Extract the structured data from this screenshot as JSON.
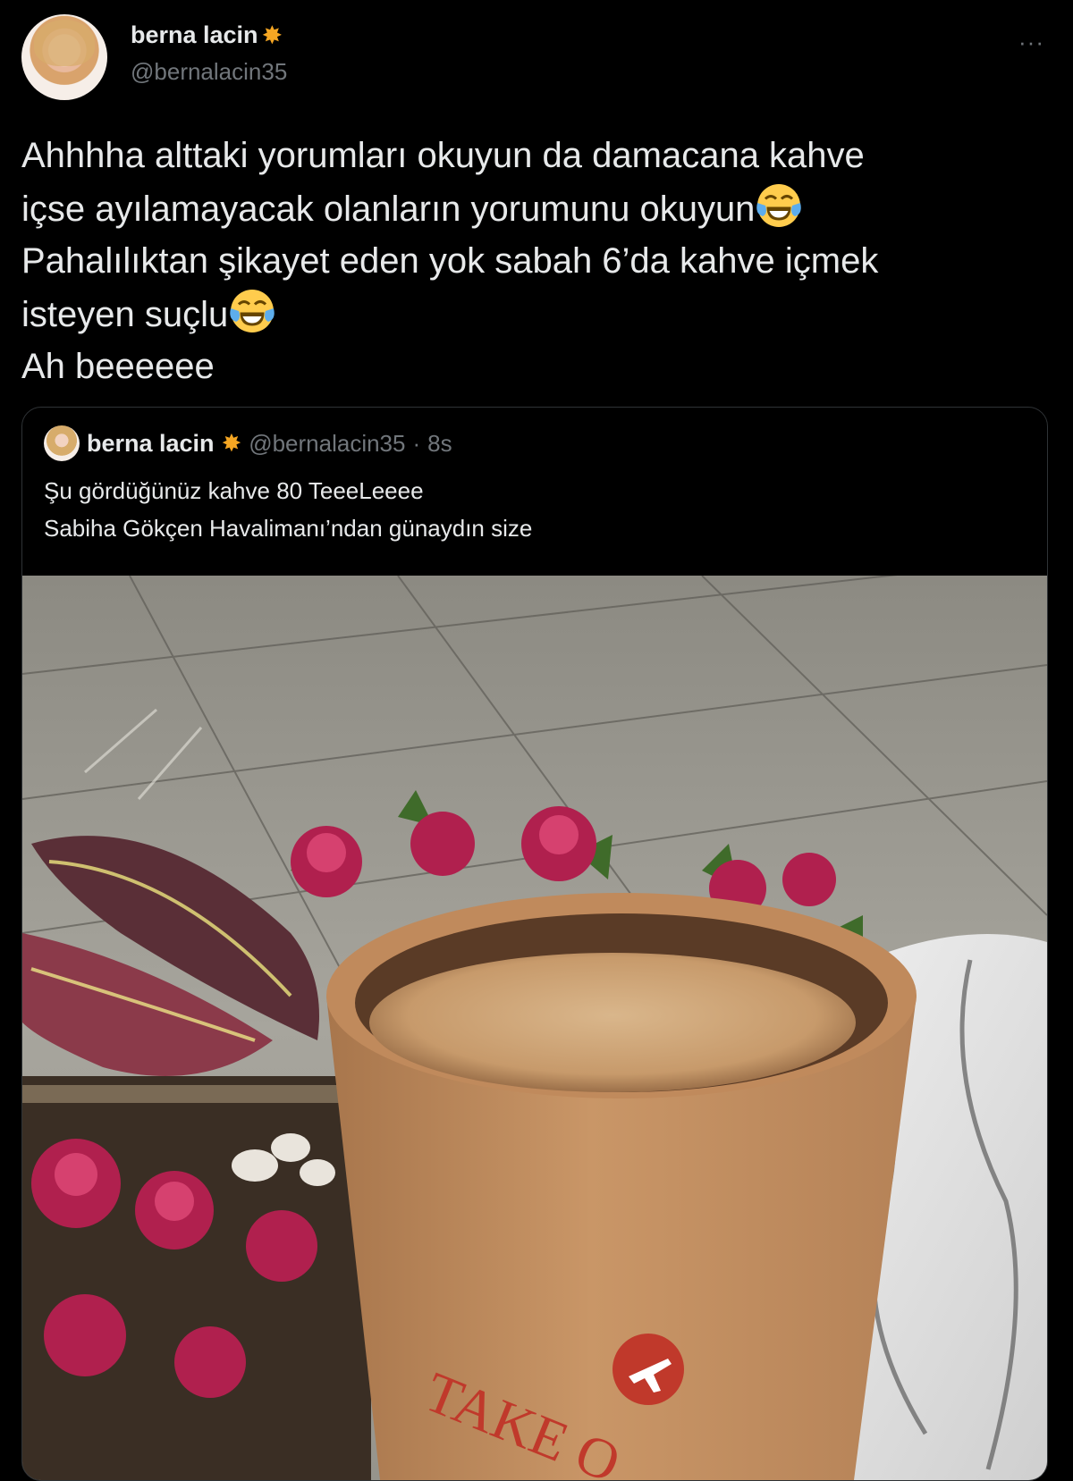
{
  "tweet": {
    "display_name": "berna lacin",
    "name_emoji": "sun-behind-small-cloud-icon",
    "handle": "@bernalacin35",
    "more_label": "···",
    "lines": [
      "Ahhhha alttaki yorumları okuyun da damacana kahve",
      "içse ayılamayacak olanların yorumunu okuyun",
      "Pahalılıktan şikayet eden yok sabah 6’da kahve içmek",
      "isteyen suçlu",
      "Ah beeeeee"
    ]
  },
  "quoted_tweet": {
    "display_name": "berna lacin",
    "handle": "@bernalacin35",
    "separator": "·",
    "time": "8s",
    "lines": [
      "Şu gördüğünüz kahve 80 TeeeLeeee",
      "Sabiha Gökçen Havalimanı’ndan günaydın size"
    ],
    "photo": {
      "cup_print": "TAKE O"
    }
  },
  "colors": {
    "background": "#000000",
    "text": "#e7e9ea",
    "secondary": "#71767b",
    "border": "#2f3336"
  }
}
